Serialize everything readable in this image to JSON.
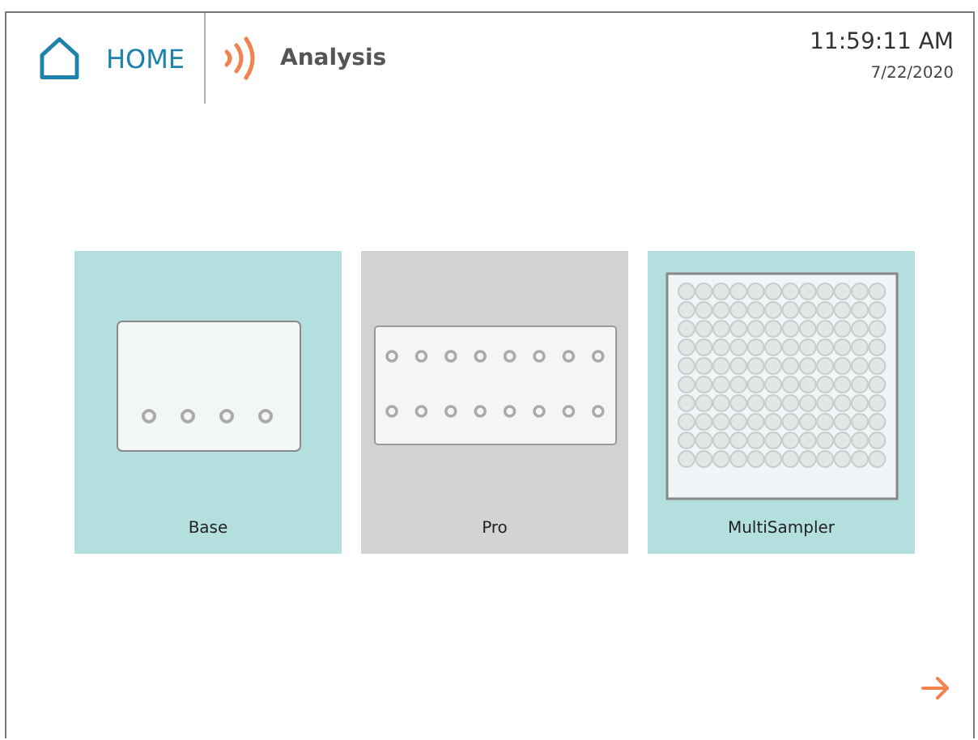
{
  "header": {
    "home_label": "HOME",
    "title": "Analysis",
    "time": "11:59:11 AM",
    "date": "7/22/2020"
  },
  "cards": [
    {
      "label": "Base",
      "kind": "base",
      "disabled": false
    },
    {
      "label": "Pro",
      "kind": "pro",
      "disabled": true
    },
    {
      "label": "MultiSampler",
      "kind": "multi",
      "disabled": false
    }
  ]
}
